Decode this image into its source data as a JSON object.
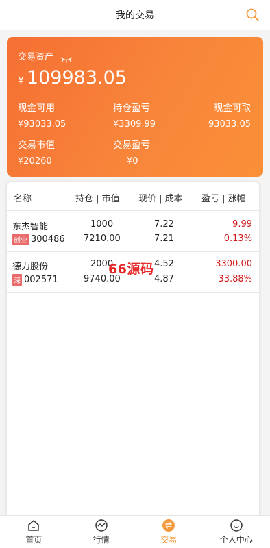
{
  "header": {
    "title": "我的交易"
  },
  "asset": {
    "label": "交易资产",
    "currency": "¥",
    "total": "109983.05",
    "cash_available_label": "现金可用",
    "cash_available_value": "¥93033.05",
    "holding_pl_label": "持仓盈亏",
    "holding_pl_value": "¥3309.99",
    "cash_withdrawable_label": "现金可取",
    "cash_withdrawable_value": "93033.05",
    "market_value_label": "交易市值",
    "market_value_value": "¥20260",
    "trade_pl_label": "交易盈亏",
    "trade_pl_value": "¥0"
  },
  "table": {
    "headers": [
      "名称",
      "持仓 | 市值",
      "现价 | 成本",
      "盈亏 | 涨幅"
    ],
    "rows": [
      {
        "name": "东杰智能",
        "tag": "创业",
        "code": "300486",
        "position": "1000",
        "market_value": "7210.00",
        "price": "7.22",
        "cost": "7.21",
        "pl": "9.99",
        "change": "0.13%"
      },
      {
        "name": "德力股份",
        "tag": "深",
        "code": "002571",
        "position": "2000",
        "market_value": "9740.00",
        "price": "4.52",
        "cost": "4.87",
        "pl": "3300.00",
        "change": "33.88%"
      }
    ]
  },
  "watermark": "66源码",
  "tabbar": [
    {
      "label": "首页",
      "icon": "home-icon"
    },
    {
      "label": "行情",
      "icon": "chart-icon"
    },
    {
      "label": "交易",
      "icon": "trade-icon",
      "active": true
    },
    {
      "label": "个人中心",
      "icon": "user-icon"
    }
  ],
  "colors": {
    "accent": "#f29a3d",
    "card_start": "#f56f33",
    "card_end": "#fb9038",
    "loss_red": "#d0191b"
  }
}
